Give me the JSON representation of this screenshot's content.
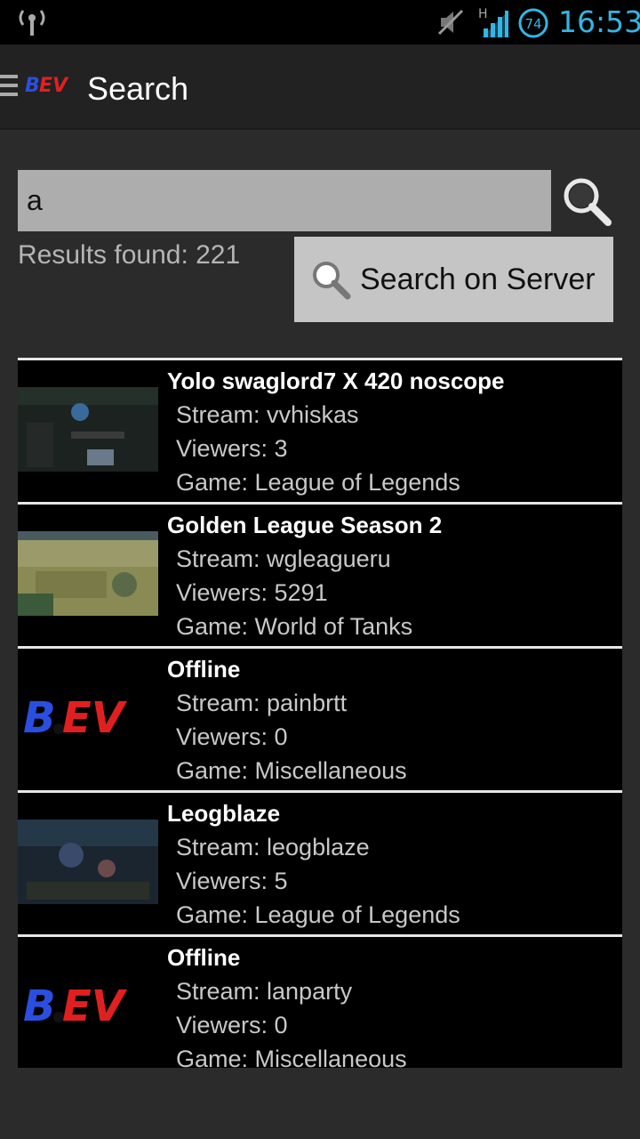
{
  "status_bar": {
    "time": "16:53",
    "battery_level": "74",
    "network_type": "H",
    "icons": [
      "antenna-icon",
      "mute-icon",
      "signal-icon",
      "battery-icon"
    ]
  },
  "action_bar": {
    "title": "Search",
    "logo_text": "BEV"
  },
  "search": {
    "value": "a",
    "results_label": "Results found: 221",
    "server_button_label": "Search on Server"
  },
  "colors": {
    "accent": "#33b5e5",
    "background": "#2b2b2b",
    "list_background": "#000000"
  },
  "streams": [
    {
      "title": "Yolo swaglord7 X 420 noscope",
      "stream": "Stream: vvhiskas",
      "viewers": "Viewers: 3",
      "game": "Game: League of Legends",
      "thumbnail": "game-screenshot-lol"
    },
    {
      "title": "Golden League Season 2",
      "stream": "Stream: wgleagueru",
      "viewers": "Viewers: 5291",
      "game": "Game: World of Tanks",
      "thumbnail": "game-screenshot-wot"
    },
    {
      "title": "Offline",
      "stream": "Stream: painbrtt",
      "viewers": "Viewers: 0",
      "game": "Game: Miscellaneous",
      "thumbnail": "bev-logo"
    },
    {
      "title": "Leogblaze",
      "stream": "Stream: leogblaze",
      "viewers": "Viewers: 5",
      "game": "Game: League of Legends",
      "thumbnail": "game-screenshot-lol"
    },
    {
      "title": "Offline",
      "stream": "Stream: lanparty",
      "viewers": "Viewers: 0",
      "game": "Game: Miscellaneous",
      "thumbnail": "bev-logo"
    }
  ]
}
